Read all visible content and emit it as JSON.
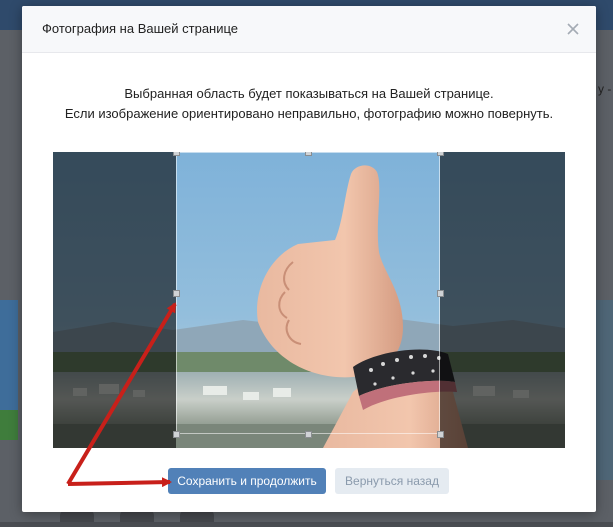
{
  "background": {
    "side_text": "у -"
  },
  "modal": {
    "title": "Фотография на Вашей странице",
    "close_icon": "close-icon",
    "instructions": [
      "Выбранная область будет показываться на Вашей странице.",
      "Если изображение ориентировано неправильно, фотографию можно повернуть."
    ],
    "crop": {
      "photo_subject": "thumbs-up-hand-photo",
      "handles": [
        "top-left",
        "top-middle",
        "top-right",
        "middle-left",
        "middle-right",
        "bottom-left",
        "bottom-middle",
        "bottom-right"
      ]
    },
    "buttons": {
      "save_label": "Сохранить и продолжить",
      "back_label": "Вернуться назад"
    }
  },
  "colors": {
    "primary_button": "#5181b8",
    "secondary_button": "#e5ebf1",
    "annotation_arrow": "#c8201a"
  }
}
